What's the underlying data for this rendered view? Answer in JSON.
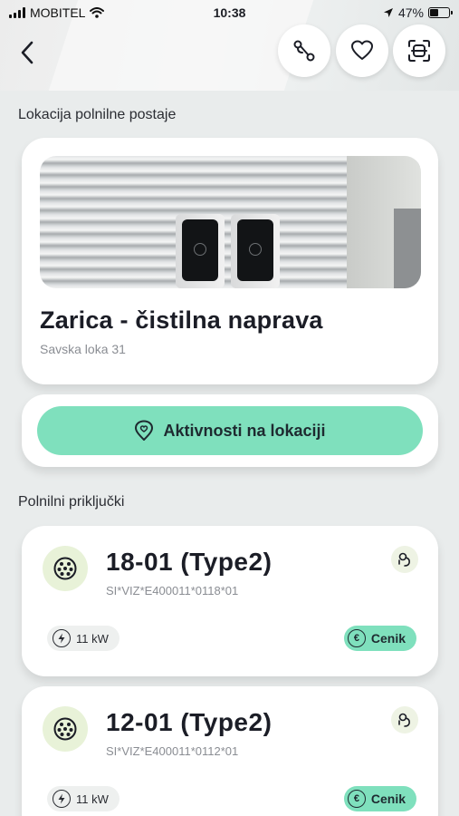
{
  "status_bar": {
    "carrier": "MOBITEL",
    "time": "10:38",
    "battery": "47%"
  },
  "header": {
    "back_icon": "chevron-left-icon",
    "actions": [
      "route-icon",
      "heart-icon",
      "scan-icon"
    ]
  },
  "location": {
    "section_label": "Lokacija polnilne postaje",
    "title": "Zarica - čistilna naprava",
    "address": "Savska loka 31",
    "activities_label": "Aktivnosti na lokaciji"
  },
  "connectors": {
    "section_label": "Polnilni priključki",
    "items": [
      {
        "name": "18-01 (Type2)",
        "id": "SI*VIZ*E400011*0118*01",
        "power": "11 kW",
        "price_label": "Cenik"
      },
      {
        "name": "12-01 (Type2)",
        "id": "SI*VIZ*E400011*0112*01",
        "power": "11 kW",
        "price_label": "Cenik"
      }
    ]
  },
  "colors": {
    "accent": "#7fe0bd",
    "background": "#e9ecec",
    "connector_icon_bg": "#e8f2d8"
  }
}
